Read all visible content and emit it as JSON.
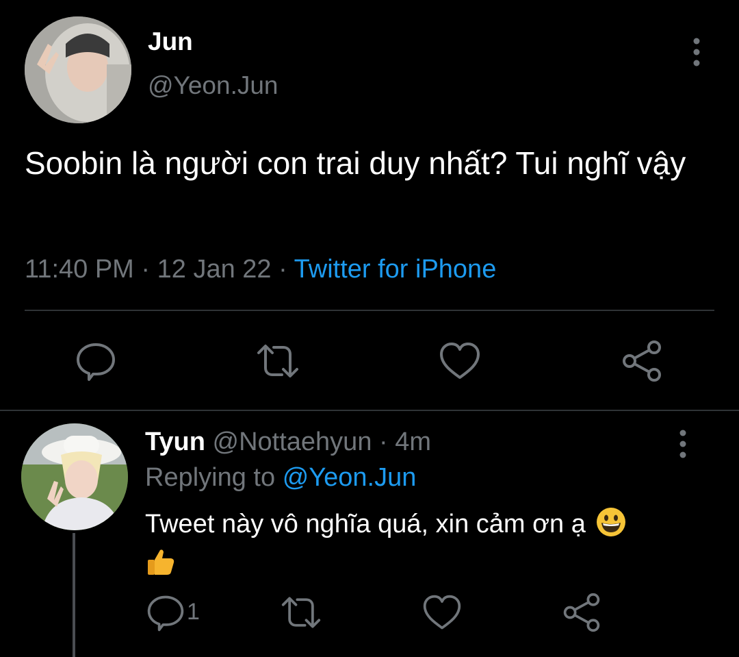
{
  "main_tweet": {
    "author_name": "Jun",
    "author_handle": "@Yeon.Jun",
    "text": "Soobin là người con trai duy nhất? Tui nghĩ vậy",
    "time": "11:40 PM",
    "date": "12 Jan 22",
    "separator": "·",
    "source": "Twitter for iPhone",
    "actions": [
      "reply-icon",
      "retweet-icon",
      "like-icon",
      "share-icon"
    ]
  },
  "reply": {
    "author_name": "Tyun",
    "author_handle": "@Nottaehyun",
    "separator": "·",
    "age": "4m",
    "replying_label": "Replying to",
    "replying_to": "@Yeon.Jun",
    "text": "Tweet này vô nghĩa quá, xin cảm ơn ạ",
    "emojis": [
      "grinning-face",
      "thumbs-up"
    ],
    "reply_count": "1",
    "actions": [
      "reply-icon",
      "retweet-icon",
      "like-icon",
      "share-icon"
    ]
  },
  "colors": {
    "background": "#000000",
    "primary_text": "#ffffff",
    "secondary_text": "#71767b",
    "accent": "#1d9bf0",
    "divider": "#2f3336"
  }
}
